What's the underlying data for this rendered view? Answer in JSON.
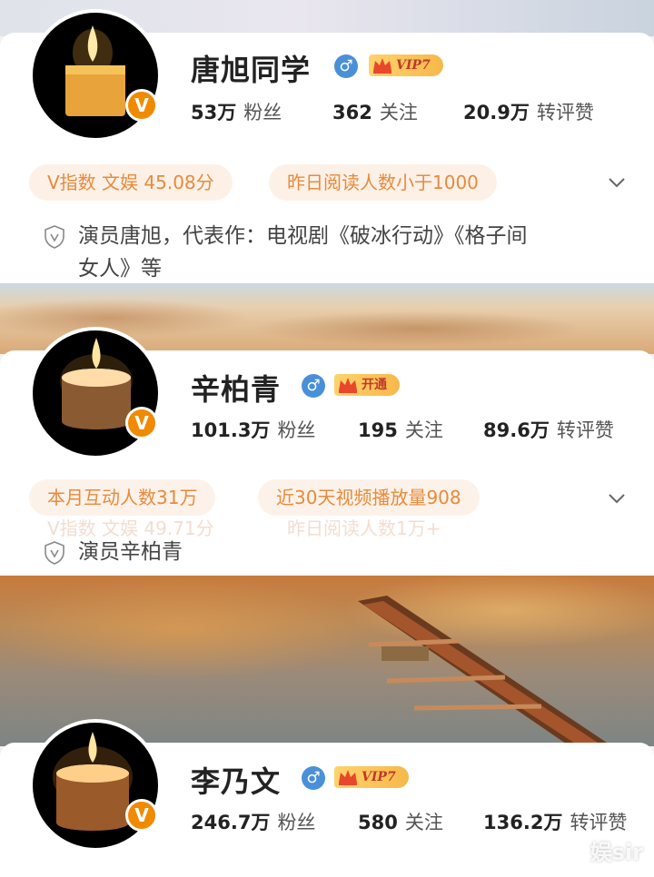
{
  "profiles": [
    {
      "name": "唐旭同学",
      "gender_icon": "♂",
      "vip_label": "VIP7",
      "verified_badge": "V",
      "stats": {
        "fans_count": "53万",
        "fans_label": "粉丝",
        "follow_count": "362",
        "follow_label": "关注",
        "likes_count": "20.9万",
        "likes_label": "转评赞"
      },
      "chips": [
        "V指数 文娱 45.08分",
        "昨日阅读人数小于1000"
      ],
      "bio_line1": "演员唐旭，代表作：电视剧《破冰行动》《格子间",
      "bio_line2": "女人》等"
    },
    {
      "name": "辛柏青",
      "gender_icon": "♂",
      "vip_label": "开通",
      "verified_badge": "V",
      "stats": {
        "fans_count": "101.3万",
        "fans_label": "粉丝",
        "follow_count": "195",
        "follow_label": "关注",
        "likes_count": "89.6万",
        "likes_label": "转评赞"
      },
      "chips": [
        "本月互动人数31万",
        "近30天视频播放量908"
      ],
      "ghost_chips": [
        "V指数 文娱 49.71分",
        "昨日阅读人数1万+"
      ],
      "bio_line1": "演员辛柏青"
    },
    {
      "name": "李乃文",
      "gender_icon": "♂",
      "vip_label": "VIP7",
      "verified_badge": "V",
      "stats": {
        "fans_count": "246.7万",
        "fans_label": "粉丝",
        "follow_count": "580",
        "follow_label": "关注",
        "likes_count": "136.2万",
        "likes_label": "转评赞"
      }
    }
  ],
  "watermark": "娱sir",
  "colors": {
    "chip_bg": "#fdf1e7",
    "chip_text": "#e88a3c",
    "gender_blue": "#4a90d9",
    "verified_orange": "#f08a00",
    "vip_gold": "#ffd36b"
  }
}
